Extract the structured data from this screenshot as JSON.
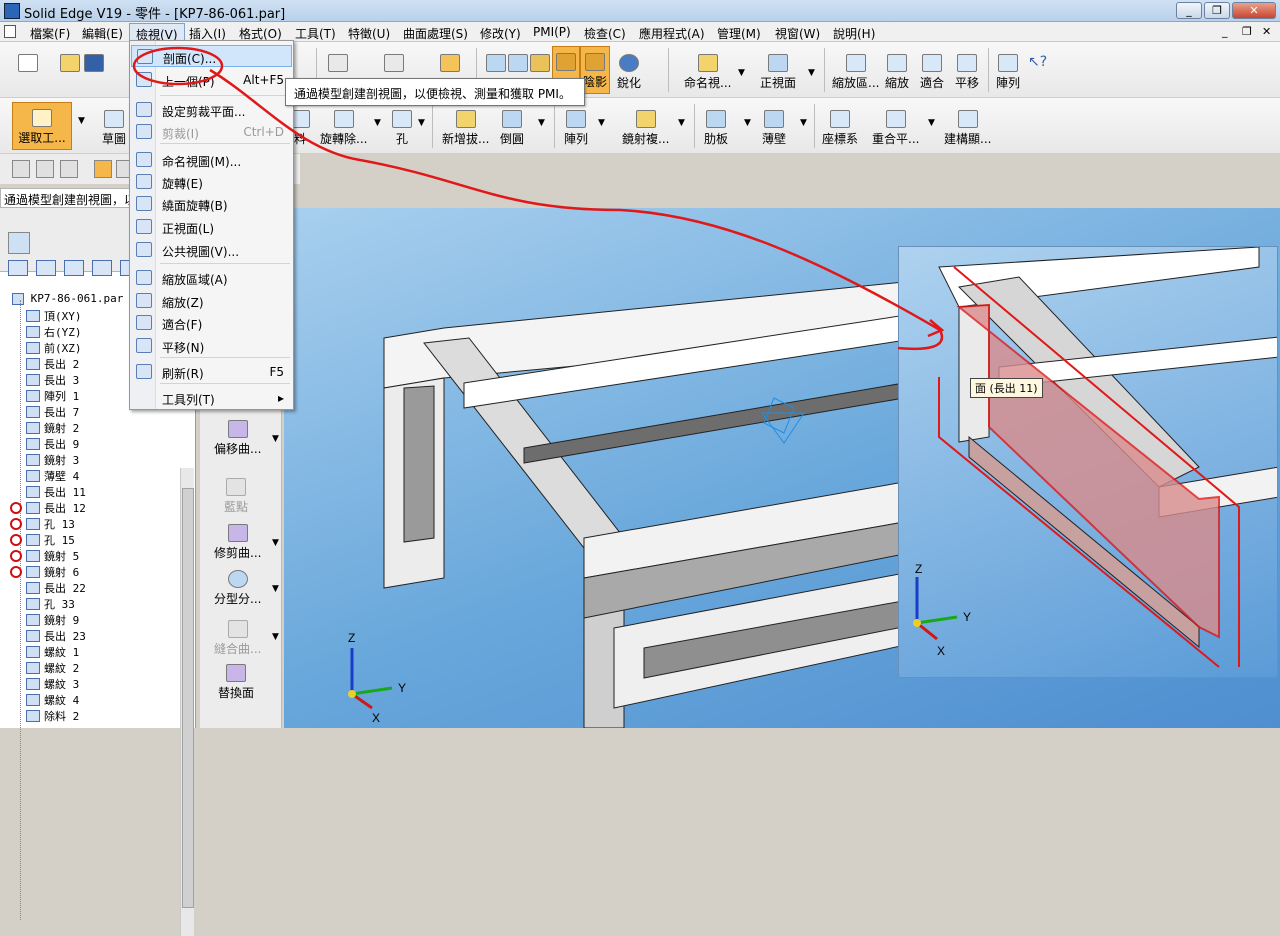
{
  "window": {
    "title": "Solid Edge V19 - 零件 - [KP7-86-061.par]",
    "buttons": [
      "_",
      "❐",
      "✕"
    ],
    "mdi_buttons": [
      "_",
      "❐",
      "✕"
    ]
  },
  "menubar": {
    "items": [
      "檔案(F)",
      "編輯(E)",
      "檢視(V)",
      "插入(I)",
      "格式(O)",
      "工具(T)",
      "特徵(U)",
      "曲面處理(S)",
      "修改(Y)",
      "PMI(P)",
      "檢查(C)",
      "應用程式(A)",
      "管理(M)",
      "視窗(W)",
      "說明(H)"
    ],
    "active_index": 2
  },
  "toolbar_top": {
    "items": [
      "剖面",
      "銳化",
      "命名視...",
      "正視面",
      "縮放區...",
      "縮放",
      "適合",
      "平移",
      "陣列"
    ],
    "shading_label": "陰影"
  },
  "toolbar_features": {
    "select_label": "選取工...",
    "items": [
      "草圖",
      "料",
      "旋轉除...",
      "孔",
      "新增拔...",
      "倒圓",
      "陣列",
      "鏡射複...",
      "肋板",
      "薄壁",
      "座標系",
      "重合平...",
      "建構顯..."
    ]
  },
  "status_line": "通過模型創建剖視圖，以",
  "dropdown": {
    "items": [
      {
        "label": "剖面(C)...",
        "shortcut": "",
        "state": "highlight"
      },
      {
        "label": "上一個(P)",
        "shortcut": "Alt+F5",
        "state": "normal"
      },
      {
        "label": "設定剪裁平面...",
        "shortcut": "",
        "state": "normal"
      },
      {
        "label": "剪裁(I)",
        "shortcut": "Ctrl+D",
        "state": "disabled"
      },
      {
        "label": "命名視圖(M)...",
        "shortcut": "",
        "state": "normal"
      },
      {
        "label": "旋轉(E)",
        "shortcut": "",
        "state": "normal"
      },
      {
        "label": "繞面旋轉(B)",
        "shortcut": "",
        "state": "normal"
      },
      {
        "label": "正視面(L)",
        "shortcut": "",
        "state": "normal"
      },
      {
        "label": "公共視圖(V)...",
        "shortcut": "",
        "state": "normal"
      },
      {
        "label": "縮放區域(A)",
        "shortcut": "",
        "state": "normal"
      },
      {
        "label": "縮放(Z)",
        "shortcut": "",
        "state": "normal"
      },
      {
        "label": "適合(F)",
        "shortcut": "",
        "state": "normal"
      },
      {
        "label": "平移(N)",
        "shortcut": "",
        "state": "normal"
      },
      {
        "label": "刷新(R)",
        "shortcut": "F5",
        "state": "normal"
      },
      {
        "label": "工具列(T)",
        "shortcut": "▸",
        "state": "normal"
      }
    ]
  },
  "tooltip": "通過模型創建剖視圖，以便檢視、測量和獲取 PMI。",
  "tree": {
    "root": "KP7-86-061.par",
    "items": [
      {
        "label": "頂(XY)",
        "error": false
      },
      {
        "label": "右(YZ)",
        "error": false
      },
      {
        "label": "前(XZ)",
        "error": false
      },
      {
        "label": "長出 2",
        "error": false
      },
      {
        "label": "長出 3",
        "error": false
      },
      {
        "label": "陣列 1",
        "error": false
      },
      {
        "label": "長出 7",
        "error": false
      },
      {
        "label": "鏡射 2",
        "error": false
      },
      {
        "label": "長出 9",
        "error": false
      },
      {
        "label": "鏡射 3",
        "error": false
      },
      {
        "label": "薄壁 4",
        "error": false
      },
      {
        "label": "長出 11",
        "error": false
      },
      {
        "label": "長出 12",
        "error": true
      },
      {
        "label": "孔 13",
        "error": true
      },
      {
        "label": "孔 15",
        "error": true
      },
      {
        "label": "鏡射 5",
        "error": true
      },
      {
        "label": "鏡射 6",
        "error": true
      },
      {
        "label": "長出 22",
        "error": false
      },
      {
        "label": "孔 33",
        "error": false
      },
      {
        "label": "鏡射 9",
        "error": false
      },
      {
        "label": "長出 23",
        "error": false
      },
      {
        "label": "螺紋 1",
        "error": false
      },
      {
        "label": "螺紋 2",
        "error": false
      },
      {
        "label": "螺紋 3",
        "error": false
      },
      {
        "label": "螺紋 4",
        "error": false
      },
      {
        "label": "除料 2",
        "error": false
      }
    ]
  },
  "vertical_toolbar": {
    "items": [
      "偏移曲...",
      "藍點",
      "修剪曲...",
      "分型分...",
      "縫合曲...",
      "替換面"
    ]
  },
  "face_label": "面 (長出 11)",
  "axes": {
    "x": "X",
    "y": "Y",
    "z": "Z"
  },
  "colors": {
    "accent_orange": "#f5b74a",
    "annotation_red": "#e01818",
    "viewport_blue": "#68a7db"
  }
}
